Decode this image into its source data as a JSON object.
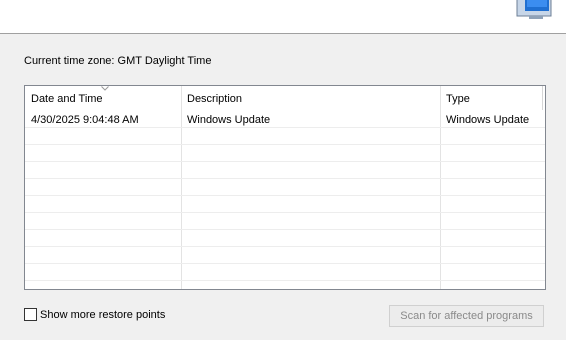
{
  "timezone": {
    "label": "Current time zone: GMT Daylight Time"
  },
  "restore_points": {
    "columns": [
      "Date and Time",
      "Description",
      "Type"
    ],
    "sort_column": "Date and Time",
    "rows": [
      {
        "date_time": "4/30/2025 9:04:48 AM",
        "description": "Windows Update",
        "type": "Windows Update"
      }
    ]
  },
  "options": {
    "show_more_label": "Show more restore points",
    "show_more_checked": false
  },
  "actions": {
    "scan_label": "Scan for affected programs",
    "scan_enabled": false
  },
  "icons": {
    "header": "system-restore-monitor-icon",
    "sort": "sort-descending-icon"
  },
  "colors": {
    "window_bg": "#f0f0f0",
    "list_bg": "#ffffff",
    "list_border": "#828790",
    "disabled_text": "#8a8a8a"
  }
}
